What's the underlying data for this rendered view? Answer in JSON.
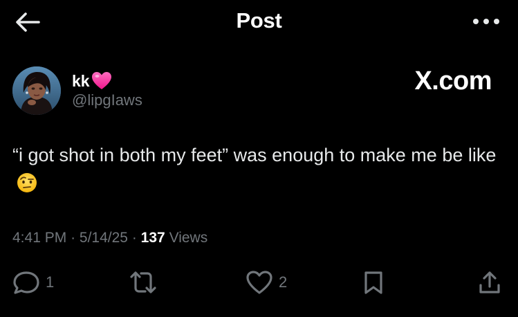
{
  "header": {
    "title": "Post",
    "back_icon": "arrow-left-icon",
    "more_icon": "more-horizontal-icon"
  },
  "author": {
    "display_name": "kk",
    "badge_emoji": "pink-heart",
    "handle": "@lipgIaws",
    "avatar_icon": "profile-avatar"
  },
  "watermark": "X.com",
  "tweet": {
    "text": "“i got shot in both my feet” was enough to make me be like",
    "emoji": "face-with-raised-eyebrow"
  },
  "meta": {
    "time": "4:41 PM",
    "separator": "·",
    "date": "5/14/25",
    "views_count": "137",
    "views_label": "Views"
  },
  "actions": {
    "reply_count": "1",
    "repost_count": "",
    "like_count": "2",
    "reply_icon": "reply-icon",
    "repost_icon": "repost-icon",
    "like_icon": "heart-outline-icon",
    "bookmark_icon": "bookmark-icon",
    "share_icon": "share-icon"
  },
  "colors": {
    "background": "#000000",
    "primary_text": "#e7e9ea",
    "secondary_text": "#71767b",
    "heart_badge": "#ff3fa4"
  }
}
